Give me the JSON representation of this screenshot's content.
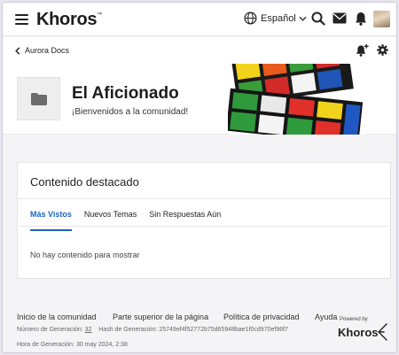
{
  "header": {
    "logo": "Khoros",
    "logo_tm": "™",
    "language": "Español"
  },
  "subheader": {
    "back_label": "Aurora Docs"
  },
  "hero": {
    "title": "El Aficionado",
    "subtitle": "¡Bienvenidos a la comunidad!"
  },
  "featured": {
    "title": "Contenido destacado",
    "tabs": [
      "Más Vistos",
      "Nuevos Temas",
      "Sin Respuestas Aún"
    ],
    "active_tab": 0,
    "empty_text": "No hay contenido para mostrar"
  },
  "footer": {
    "links": [
      "Inicio de la comunidad",
      "Parte superior de la página",
      "Política de privacidad",
      "Ayuda"
    ],
    "generation_label": "Número de Generación:",
    "generation_number": "32",
    "hash_label": "Hash de Generación:",
    "hash_value": "25749ef4f52772b75d65948bae1f0cd970ef96f7",
    "time_label": "Hora de Generación:",
    "time_value": "30 may 2024, 2:38",
    "powered_by": "Powered by",
    "powered_logo": "Khoros"
  },
  "icons": {
    "menu": "menu-icon",
    "globe": "globe-icon",
    "search": "search-icon",
    "mail": "mail-icon",
    "bell": "bell-icon",
    "bell_plus": "bell-plus-icon",
    "settings": "gear-icon",
    "folder": "folder-icon"
  }
}
